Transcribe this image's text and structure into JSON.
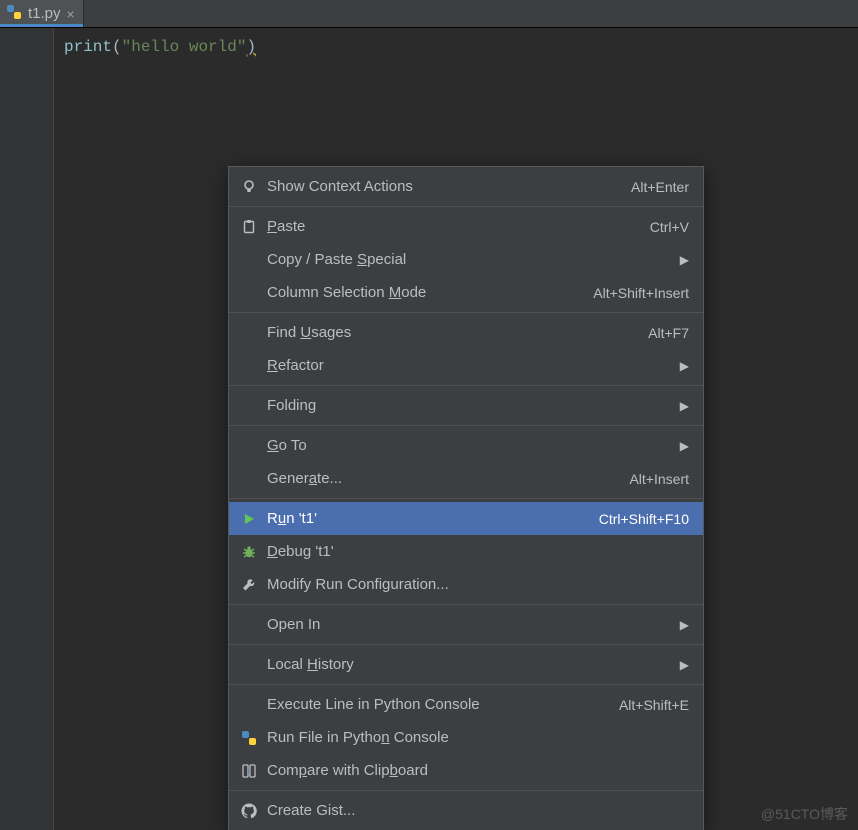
{
  "tab": {
    "filename": "t1.py"
  },
  "code": {
    "func": "print",
    "open": "(",
    "str": "\"hello world\"",
    "close": ")"
  },
  "menu": {
    "items": [
      {
        "icon": "bulb-icon",
        "label_pre": "",
        "label_u": "",
        "label_post": "Show Context Actions",
        "shortcut": "Alt+Enter",
        "sub": false
      },
      {
        "sep": true
      },
      {
        "icon": "clipboard-icon",
        "label_pre": "",
        "label_u": "P",
        "label_post": "aste",
        "shortcut": "Ctrl+V",
        "sub": false
      },
      {
        "icon": "",
        "label_pre": "Copy / Paste ",
        "label_u": "S",
        "label_post": "pecial",
        "shortcut": "",
        "sub": true
      },
      {
        "icon": "",
        "label_pre": "Column Selection ",
        "label_u": "M",
        "label_post": "ode",
        "shortcut": "Alt+Shift+Insert",
        "sub": false
      },
      {
        "sep": true
      },
      {
        "icon": "",
        "label_pre": "Find ",
        "label_u": "U",
        "label_post": "sages",
        "shortcut": "Alt+F7",
        "sub": false
      },
      {
        "icon": "",
        "label_pre": "",
        "label_u": "R",
        "label_post": "efactor",
        "shortcut": "",
        "sub": true
      },
      {
        "sep": true
      },
      {
        "icon": "",
        "label_pre": "Foldin",
        "label_u": "g",
        "label_post": "",
        "shortcut": "",
        "sub": true
      },
      {
        "sep": true
      },
      {
        "icon": "",
        "label_pre": "",
        "label_u": "G",
        "label_post": "o To",
        "shortcut": "",
        "sub": true
      },
      {
        "icon": "",
        "label_pre": "Gener",
        "label_u": "a",
        "label_post": "te...",
        "shortcut": "Alt+Insert",
        "sub": false
      },
      {
        "sep": true
      },
      {
        "icon": "run-icon",
        "label_pre": "R",
        "label_u": "u",
        "label_post": "n 't1'",
        "shortcut": "Ctrl+Shift+F10",
        "sub": false,
        "selected": true
      },
      {
        "icon": "bug-icon",
        "label_pre": "",
        "label_u": "D",
        "label_post": "ebug 't1'",
        "shortcut": "",
        "sub": false
      },
      {
        "icon": "wrench-icon",
        "label_pre": "Modify Run Configuration...",
        "label_u": "",
        "label_post": "",
        "shortcut": "",
        "sub": false
      },
      {
        "sep": true
      },
      {
        "icon": "",
        "label_pre": "Open In",
        "label_u": "",
        "label_post": "",
        "shortcut": "",
        "sub": true
      },
      {
        "sep": true
      },
      {
        "icon": "",
        "label_pre": "Local ",
        "label_u": "H",
        "label_post": "istory",
        "shortcut": "",
        "sub": true
      },
      {
        "sep": true
      },
      {
        "icon": "",
        "label_pre": "Execute Line in Python Console",
        "label_u": "",
        "label_post": "",
        "shortcut": "Alt+Shift+E",
        "sub": false
      },
      {
        "icon": "python-icon",
        "label_pre": "Run File in Pytho",
        "label_u": "n",
        "label_post": " Console",
        "shortcut": "",
        "sub": false
      },
      {
        "icon": "compare-icon",
        "label_pre": "Com",
        "label_u": "p",
        "label_post": "are with Clip",
        "label_u2": "b",
        "label_post2": "oard",
        "shortcut": "",
        "sub": false
      },
      {
        "sep": true
      },
      {
        "icon": "github-icon",
        "label_pre": "Create Gist...",
        "label_u": "",
        "label_post": "",
        "shortcut": "",
        "sub": false
      }
    ]
  },
  "icons": {
    "bulb-icon": "bulb",
    "clipboard-icon": "clipboard",
    "run-icon": "run",
    "bug-icon": "bug",
    "wrench-icon": "wrench",
    "python-icon": "python",
    "compare-icon": "compare",
    "github-icon": "github"
  },
  "watermark": "@51CTO博客"
}
